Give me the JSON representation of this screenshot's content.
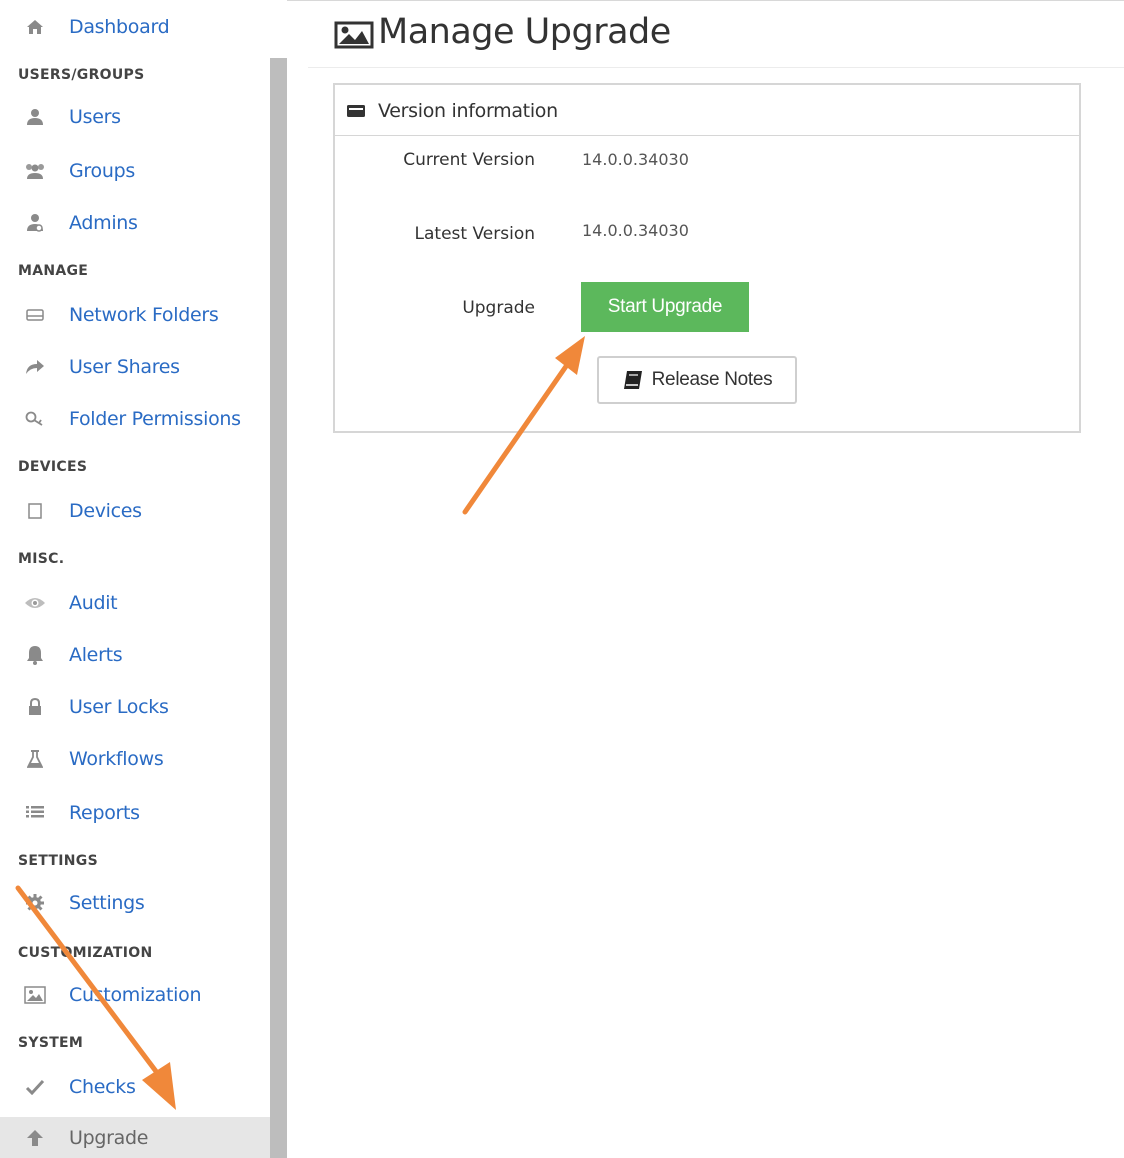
{
  "sidebar": {
    "items": [
      {
        "label": "Dashboard",
        "icon": "home-icon"
      },
      {
        "label": "Users",
        "icon": "user-icon"
      },
      {
        "label": "Groups",
        "icon": "group-icon"
      },
      {
        "label": "Admins",
        "icon": "admin-icon"
      },
      {
        "label": "Network Folders",
        "icon": "hard-drive-icon"
      },
      {
        "label": "User Shares",
        "icon": "share-icon"
      },
      {
        "label": "Folder Permissions",
        "icon": "key-icon"
      },
      {
        "label": "Devices",
        "icon": "device-icon"
      },
      {
        "label": "Audit",
        "icon": "eye-icon"
      },
      {
        "label": "Alerts",
        "icon": "bell-icon"
      },
      {
        "label": "User Locks",
        "icon": "lock-icon"
      },
      {
        "label": "Workflows",
        "icon": "flask-icon"
      },
      {
        "label": "Reports",
        "icon": "list-icon"
      },
      {
        "label": "Settings",
        "icon": "gear-icon"
      },
      {
        "label": "Customization",
        "icon": "image-icon"
      },
      {
        "label": "Checks",
        "icon": "check-icon"
      },
      {
        "label": "Upgrade",
        "icon": "arrow-up-icon"
      }
    ],
    "sections": [
      "USERS/GROUPS",
      "MANAGE",
      "DEVICES",
      "MISC.",
      "SETTINGS",
      "CUSTOMIZATION",
      "SYSTEM"
    ],
    "active_item": "Upgrade"
  },
  "main": {
    "title": "Manage Upgrade",
    "panel": {
      "heading": "Version information",
      "current_version_label": "Current Version",
      "current_version_value": "14.0.0.34030",
      "latest_version_label": "Latest Version",
      "latest_version_value": "14.0.0.34030",
      "upgrade_label": "Upgrade",
      "start_upgrade_button": "Start Upgrade",
      "release_notes_button": "Release Notes"
    }
  },
  "colors": {
    "link": "#2a6bc4",
    "success": "#5cb85c",
    "annotation_arrow": "#f0883a",
    "active_bg": "#e6e6e6"
  }
}
